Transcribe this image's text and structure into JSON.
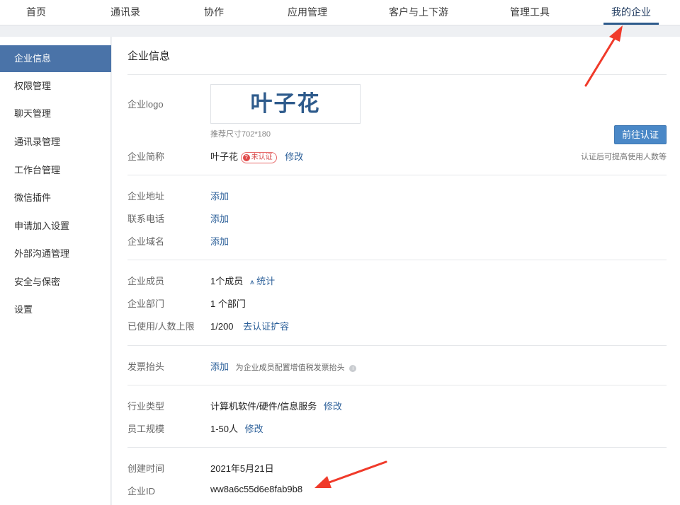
{
  "topnav": {
    "tabs": [
      {
        "label": "首页"
      },
      {
        "label": "通讯录"
      },
      {
        "label": "协作"
      },
      {
        "label": "应用管理"
      },
      {
        "label": "客户与上下游"
      },
      {
        "label": "管理工具"
      },
      {
        "label": "我的企业",
        "active": true
      }
    ]
  },
  "sidebar": {
    "items": [
      {
        "label": "企业信息"
      },
      {
        "label": "权限管理"
      },
      {
        "label": "聊天管理"
      },
      {
        "label": "通讯录管理"
      },
      {
        "label": "工作台管理"
      },
      {
        "label": "微信插件"
      },
      {
        "label": "申请加入设置"
      },
      {
        "label": "外部沟通管理"
      },
      {
        "label": "安全与保密"
      },
      {
        "label": "设置"
      }
    ]
  },
  "main": {
    "title": "企业信息",
    "logo": {
      "label": "企业logo",
      "text": "叶子花",
      "hint": "推荐尺寸702*180"
    },
    "verify": {
      "button": "前往认证",
      "hint": "认证后可提高使用人数等"
    },
    "short_name": {
      "label": "企业简称",
      "value": "叶子花",
      "badge": "未认证",
      "edit": "修改"
    },
    "address": {
      "label": "企业地址",
      "action": "添加"
    },
    "phone": {
      "label": "联系电话",
      "action": "添加"
    },
    "domain": {
      "label": "企业域名",
      "action": "添加"
    },
    "members": {
      "label": "企业成员",
      "value": "1个成员",
      "stats": "统计"
    },
    "departments": {
      "label": "企业部门",
      "value": "1 个部门"
    },
    "quota": {
      "label": "已使用/人数上限",
      "value": "1/200",
      "action": "去认证扩容"
    },
    "invoice": {
      "label": "发票抬头",
      "action": "添加",
      "note": "为企业成员配置增值税发票抬头"
    },
    "industry": {
      "label": "行业类型",
      "value": "计算机软件/硬件/信息服务",
      "edit": "修改"
    },
    "scale": {
      "label": "员工规模",
      "value": "1-50人",
      "edit": "修改"
    },
    "created": {
      "label": "创建时间",
      "value": "2021年5月21日"
    },
    "corp_id": {
      "label": "企业ID",
      "value": "ww8a6c55d6e8fab9b8"
    }
  },
  "colors": {
    "accent": "#4a73a8",
    "link": "#2b5f99",
    "button": "#4a88c7",
    "arrow": "#f03a2a",
    "warn": "#e04848"
  }
}
